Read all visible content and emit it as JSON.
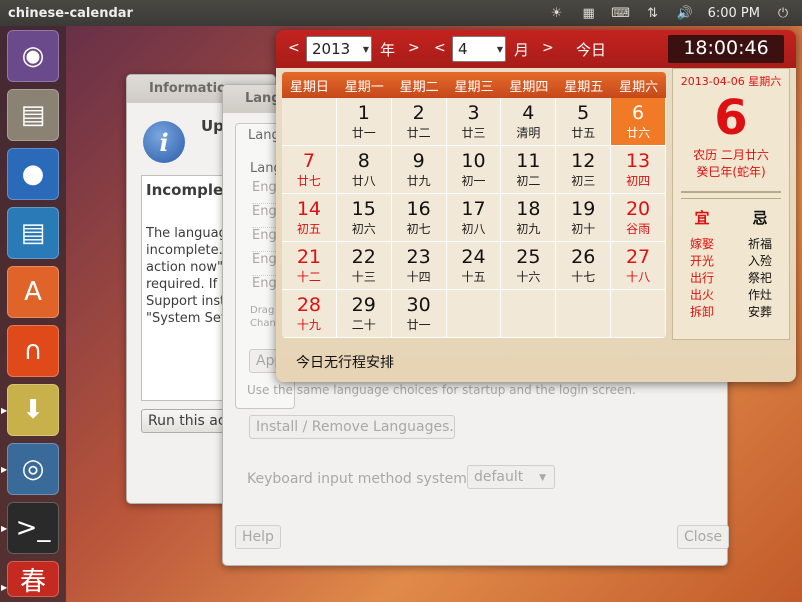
{
  "top_panel": {
    "app_title": "chinese-calendar",
    "clock": "6:00 PM"
  },
  "launcher": [
    {
      "icon": "ubuntu-icon"
    },
    {
      "icon": "files-icon"
    },
    {
      "icon": "firefox-icon"
    },
    {
      "icon": "writer-icon"
    },
    {
      "icon": "software-center-icon"
    },
    {
      "icon": "ubuntu-one-icon"
    },
    {
      "icon": "update-manager-icon"
    },
    {
      "icon": "workspace-icon"
    },
    {
      "icon": "terminal-icon"
    },
    {
      "icon": "chinese-calendar-icon"
    }
  ],
  "info_window": {
    "title": "Informatio",
    "heading": "Up",
    "text": "Incomple",
    "body": "The languag incomplete. action now\" required. If Support inst \"System Set",
    "run_button": "Run this act"
  },
  "lang_window": {
    "title": "Lang",
    "tab": "Lang",
    "label": "Lang",
    "list": [
      "Eng",
      "Eng",
      "Eng",
      "Eng",
      "Eng"
    ],
    "drag": "Drag",
    "chan": "Chan",
    "apply_button": "App",
    "note": "Use the same language choices for startup and the login screen.",
    "install_button": "Install / Remove Languages...",
    "keyboard_label": "Keyboard input method system:",
    "keyboard_value": "default",
    "help_button": "Help",
    "close_button": "Close"
  },
  "calendar": {
    "prev": "<",
    "next": ">",
    "year": "2013",
    "year_label": "年",
    "month": "4",
    "month_label": "月",
    "today_button": "今日",
    "time": "18:00:46",
    "weekdays": [
      "星期日",
      "星期一",
      "星期二",
      "星期三",
      "星期四",
      "星期五",
      "星期六"
    ],
    "days": [
      {
        "d": "",
        "l": ""
      },
      {
        "d": "1",
        "l": "廿一"
      },
      {
        "d": "2",
        "l": "廿二"
      },
      {
        "d": "3",
        "l": "廿三"
      },
      {
        "d": "4",
        "l": "清明"
      },
      {
        "d": "5",
        "l": "廿五"
      },
      {
        "d": "6",
        "l": "廿六"
      },
      {
        "d": "7",
        "l": "廿七"
      },
      {
        "d": "8",
        "l": "廿八"
      },
      {
        "d": "9",
        "l": "廿九"
      },
      {
        "d": "10",
        "l": "初一"
      },
      {
        "d": "11",
        "l": "初二"
      },
      {
        "d": "12",
        "l": "初三"
      },
      {
        "d": "13",
        "l": "初四"
      },
      {
        "d": "14",
        "l": "初五"
      },
      {
        "d": "15",
        "l": "初六"
      },
      {
        "d": "16",
        "l": "初七"
      },
      {
        "d": "17",
        "l": "初八"
      },
      {
        "d": "18",
        "l": "初九"
      },
      {
        "d": "19",
        "l": "初十"
      },
      {
        "d": "20",
        "l": "谷雨"
      },
      {
        "d": "21",
        "l": "十二"
      },
      {
        "d": "22",
        "l": "十三"
      },
      {
        "d": "23",
        "l": "十四"
      },
      {
        "d": "24",
        "l": "十五"
      },
      {
        "d": "25",
        "l": "十六"
      },
      {
        "d": "26",
        "l": "十七"
      },
      {
        "d": "27",
        "l": "十八"
      },
      {
        "d": "28",
        "l": "十九"
      },
      {
        "d": "29",
        "l": "二十"
      },
      {
        "d": "30",
        "l": "廿一"
      },
      {
        "d": "",
        "l": ""
      },
      {
        "d": "",
        "l": ""
      },
      {
        "d": "",
        "l": ""
      },
      {
        "d": "",
        "l": ""
      }
    ],
    "side_date": "2013-04-06 星期六",
    "side_day": "6",
    "lunar_date": "农历 二月廿六",
    "ganzhi": "癸巳年(蛇年)",
    "yi_label": "宜",
    "yi": [
      "嫁娶",
      "开光",
      "出行",
      "出火",
      "拆卸"
    ],
    "ji_label": "忌",
    "ji": [
      "祈福",
      "入殓",
      "祭祀",
      "作灶",
      "安葬"
    ],
    "schedule": "今日无行程安排"
  },
  "colors": {
    "accent": "#e56b2a",
    "calendar_red": "#c4231f",
    "today_orange": "#f07a25"
  }
}
